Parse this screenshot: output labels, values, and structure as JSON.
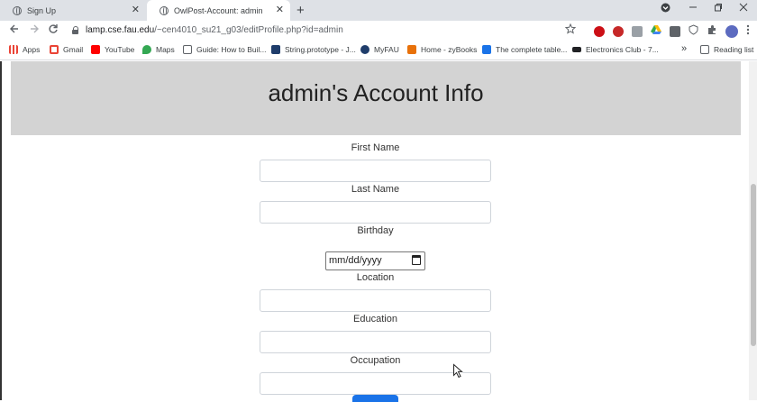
{
  "browser": {
    "tabs": [
      {
        "title": "Sign Up"
      },
      {
        "title": "OwlPost-Account: admin"
      }
    ],
    "new_tab_symbol": "+",
    "close_symbol": "✕",
    "url_host": "lamp.cse.fau.edu",
    "url_path": "/~cen4010_su21_g03/editProfile.php?id=admin",
    "reading_list": "Reading list",
    "bookmarks": [
      {
        "label": "Apps",
        "icon": "apps-grid-icon",
        "color": "#ea4335"
      },
      {
        "label": "Gmail",
        "icon": "gmail-icon",
        "color": "#ea4335"
      },
      {
        "label": "YouTube",
        "icon": "youtube-icon",
        "color": "#ff0000"
      },
      {
        "label": "Maps",
        "icon": "maps-pin-icon",
        "color": "#34a853"
      },
      {
        "label": "Guide: How to Buil...",
        "icon": "guide-icon",
        "color": "#5f6368"
      },
      {
        "label": "String.prototype - J...",
        "icon": "mdn-icon",
        "color": "#1f3d6b"
      },
      {
        "label": "MyFAU",
        "icon": "owl-icon",
        "color": "#1f3d6b"
      },
      {
        "label": "Home - zyBooks",
        "icon": "zybooks-icon",
        "color": "#e8710a"
      },
      {
        "label": "The complete table...",
        "icon": "bookmark-blue-icon",
        "color": "#1a73e8"
      },
      {
        "label": "Electronics Club - 7...",
        "icon": "electronics-icon",
        "color": "#202124"
      }
    ],
    "bookmark_overflow": "»"
  },
  "page": {
    "title": "admin's Account Info",
    "fields": {
      "first_name": "First Name",
      "last_name": "Last Name",
      "birthday": "Birthday",
      "birthday_placeholder": "mm/dd/yyyy",
      "location": "Location",
      "education": "Education",
      "occupation": "Occupation"
    }
  },
  "colors": {
    "banner": "#d3d3d3",
    "submit": "#1a73e8"
  }
}
